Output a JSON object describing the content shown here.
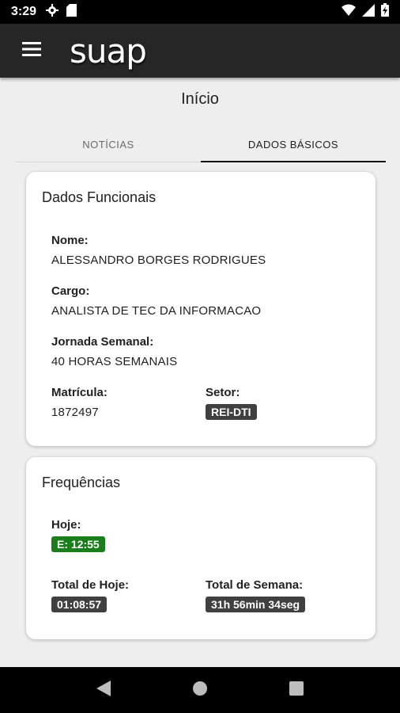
{
  "status_bar": {
    "time": "3:29",
    "icons": [
      "gear-icon",
      "sd-card-icon",
      "wifi-icon",
      "signal-icon",
      "battery-icon"
    ]
  },
  "app_bar": {
    "logo": "suap",
    "menu_icon": "hamburger-menu-icon"
  },
  "page": {
    "title": "Início"
  },
  "tabs": [
    {
      "label": "NOTÍCIAS",
      "active": false
    },
    {
      "label": "DADOS BÁSICOS",
      "active": true
    }
  ],
  "dados_funcionais": {
    "title": "Dados Funcionais",
    "nome_label": "Nome:",
    "nome_value": "ALESSANDRO BORGES RODRIGUES",
    "cargo_label": "Cargo:",
    "cargo_value": "ANALISTA DE TEC DA INFORMACAO",
    "jornada_label": "Jornada Semanal:",
    "jornada_value": "40 HORAS SEMANAIS",
    "matricula_label": "Matrícula:",
    "matricula_value": "1872497",
    "setor_label": "Setor:",
    "setor_value": "REI-DTI"
  },
  "frequencias": {
    "title": "Frequências",
    "hoje_label": "Hoje:",
    "hoje_value": "E: 12:55",
    "total_hoje_label": "Total de Hoje:",
    "total_hoje_value": "01:08:57",
    "total_semana_label": "Total de Semana:",
    "total_semana_value": "31h 56min 34seg"
  },
  "colors": {
    "app_bar": "#262626",
    "badge_dark": "#404040",
    "badge_green": "#1a7f1a",
    "background": "#eeeeee"
  },
  "nav_bar": {
    "icons": [
      "back-icon",
      "home-icon",
      "recents-icon"
    ]
  }
}
